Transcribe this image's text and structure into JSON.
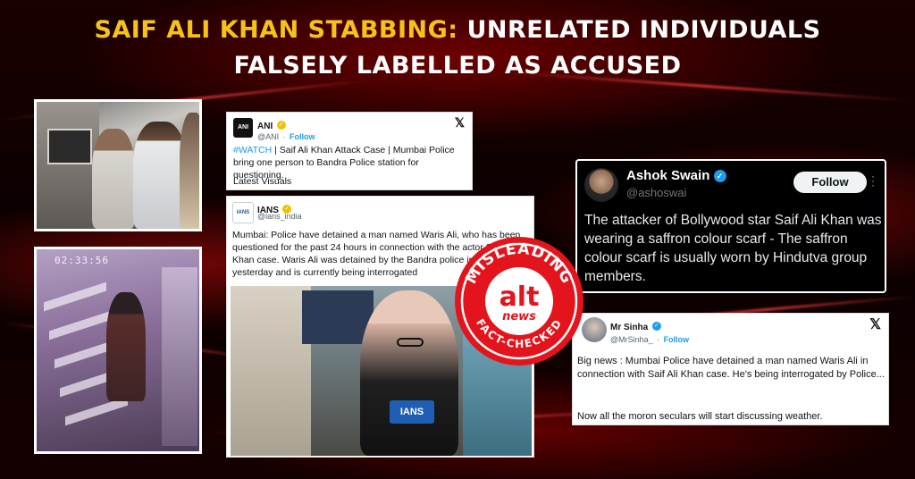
{
  "headline": {
    "part1": "Saif Ali Khan stabbing:",
    "part2": "Unrelated individuals",
    "line2": "falsely labelled as accused",
    "highlight_color": "#f6c21a"
  },
  "photos": {
    "cctv_timestamp": "02:33:56"
  },
  "tweet_ani": {
    "name": "ANI",
    "avatar_text": "ANI",
    "handle": "@ANI",
    "follow": "Follow",
    "hashtag": "#WATCH",
    "text": " | Saif Ali Khan Attack Case | Mumbai Police bring one person to Bandra Police station for questioning.",
    "footer": "Latest Visuals"
  },
  "tweet_ians": {
    "name": "IANS",
    "avatar_text": "IANS",
    "handle": "@ians_india",
    "text": "Mumbai: Police have detained a man named Waris Ali, who has been questioned for the past 24 hours in connection with the actor Saif Ali Khan case. Waris Ali was detained by the Bandra police in Mumbai yesterday and is currently being interrogated",
    "mic_label": "IANS"
  },
  "tweet_swain": {
    "name": "Ashok Swain",
    "handle": "@ashoswai",
    "follow": "Follow",
    "more": "⋮",
    "text": "The attacker of Bollywood star Saif Ali Khan was wearing a saffron colour scarf - The saffron colour scarf is usually worn by Hindutva group members."
  },
  "tweet_sinha": {
    "name": "Mr Sinha",
    "handle": "@MrSinha_",
    "follow": "Follow",
    "text1": "Big news : Mumbai Police have detained a man named Waris Ali in connection with Saif Ali Khan case. He's being interrogated by Police...",
    "text2": "Now all the moron seculars will start discussing weather."
  },
  "stamp": {
    "top_text": "MISLEADING",
    "logo_top": "alt",
    "logo_bottom": "news",
    "bottom_text": "FACT-CHECKED",
    "color": "#e3141c"
  },
  "x_icon": "𝕏"
}
